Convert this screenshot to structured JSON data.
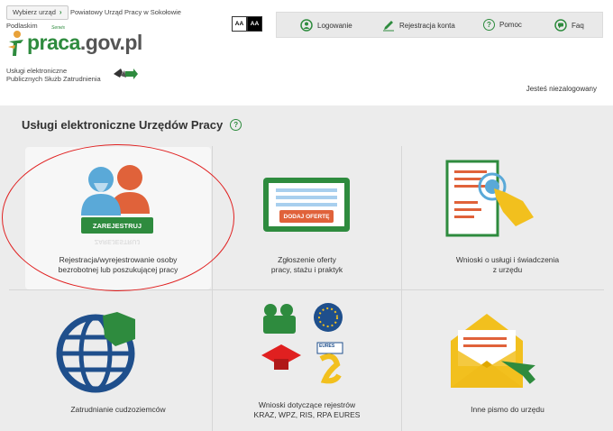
{
  "header": {
    "office_button": "Wybierz urząd",
    "office_name": "Powiatowy Urząd Pracy w Sokołowie",
    "office_name_2": "Podlaskim",
    "logo_text_main": "praca",
    "logo_text_domain": ".gov.pl",
    "logo_small": "Serwis",
    "tagline_1": "Usługi elektroniczne",
    "tagline_2": "Publicznych Służb Zatrudnienia",
    "contrast_normal": "AA",
    "contrast_high": "AA",
    "user_status": "Jesteś niezalogowany"
  },
  "topnav": {
    "items": [
      {
        "label": "Logowanie",
        "icon": "user-icon"
      },
      {
        "label": "Rejestracja konta",
        "icon": "pencil-icon"
      },
      {
        "label": "Pomoc",
        "icon": "question-icon"
      },
      {
        "label": "Faq",
        "icon": "chat-icon"
      }
    ]
  },
  "main": {
    "title": "Usługi elektroniczne Urzędów Pracy",
    "tiles": [
      {
        "label_1": "Rejestracja/wyrejestrowanie osoby",
        "label_2": "bezrobotnej lub poszukującej pracy",
        "badge": "ZAREJESTRUJ",
        "badge_reflection": "ZAREJESTRUJ",
        "icon": "people-icon"
      },
      {
        "label_1": "Zgłoszenie oferty",
        "label_2": "pracy, stażu i praktyk",
        "badge": "DODAJ OFERTĘ",
        "icon": "monitor-icon"
      },
      {
        "label_1": "Wnioski o usługi i świadczenia",
        "label_2": "z urzędu",
        "icon": "document-hand-icon"
      },
      {
        "label_1": "Zatrudnianie cudzoziemców",
        "label_2": "",
        "icon": "globe-icon"
      },
      {
        "label_1": "Wnioski dotyczące rejestrów",
        "label_2": "KRAZ, WPZ, RIS, RPA EURES",
        "icon": "registers-icon",
        "eures_text": "EURES"
      },
      {
        "label_1": "Inne pismo do urzędu",
        "label_2": "",
        "icon": "envelope-icon"
      }
    ]
  },
  "colors": {
    "brand_green": "#2e8b3e",
    "accent_red": "#e02020",
    "background": "#ececec"
  }
}
